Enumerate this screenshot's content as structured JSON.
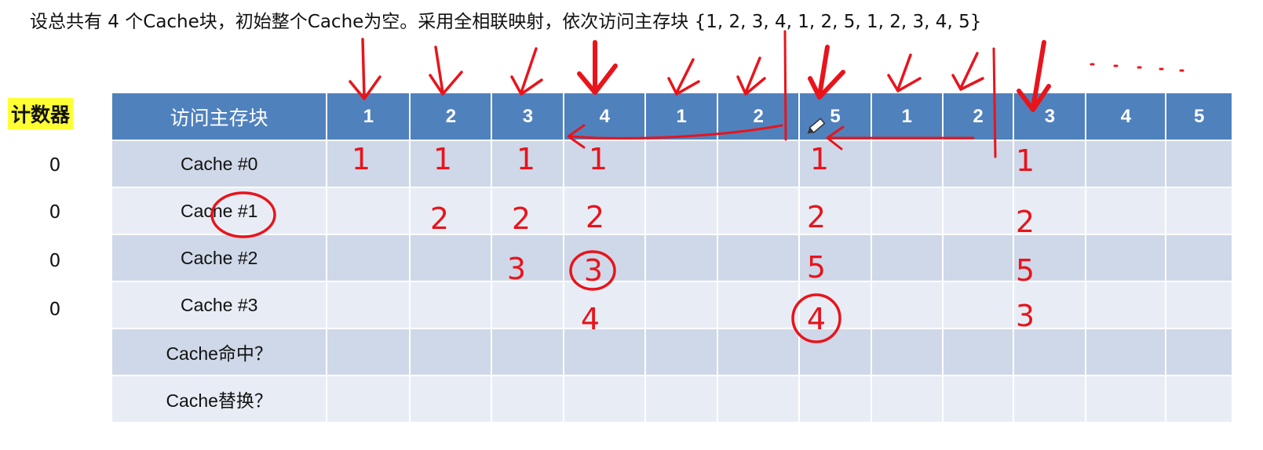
{
  "problem_text": "设总共有 4 个Cache块，初始整个Cache为空。采用全相联映射，依次访问主存块 {1, 2, 3, 4, 1, 2, 5, 1, 2, 3, 4, 5}",
  "counter": {
    "title": "计数器",
    "values": [
      "0",
      "0",
      "0",
      "0"
    ]
  },
  "table": {
    "header_label": "访问主存块",
    "sequence": [
      "1",
      "2",
      "3",
      "4",
      "1",
      "2",
      "5",
      "1",
      "2",
      "3",
      "4",
      "5"
    ],
    "row_labels": [
      "Cache #0",
      "Cache #1",
      "Cache #2",
      "Cache #3",
      "Cache命中？",
      "Cache替换？"
    ]
  },
  "annotations": {
    "ink_color": "#e8141c",
    "handwritten": {
      "col1": [
        "1"
      ],
      "col2": [
        "1",
        "2"
      ],
      "col3": [
        "1",
        "2",
        "3"
      ],
      "col4": [
        "1",
        "2",
        "3",
        "4"
      ],
      "col7": [
        "1",
        "2",
        "5",
        "4"
      ],
      "col10": [
        "1",
        "2",
        "5",
        "3"
      ]
    }
  }
}
